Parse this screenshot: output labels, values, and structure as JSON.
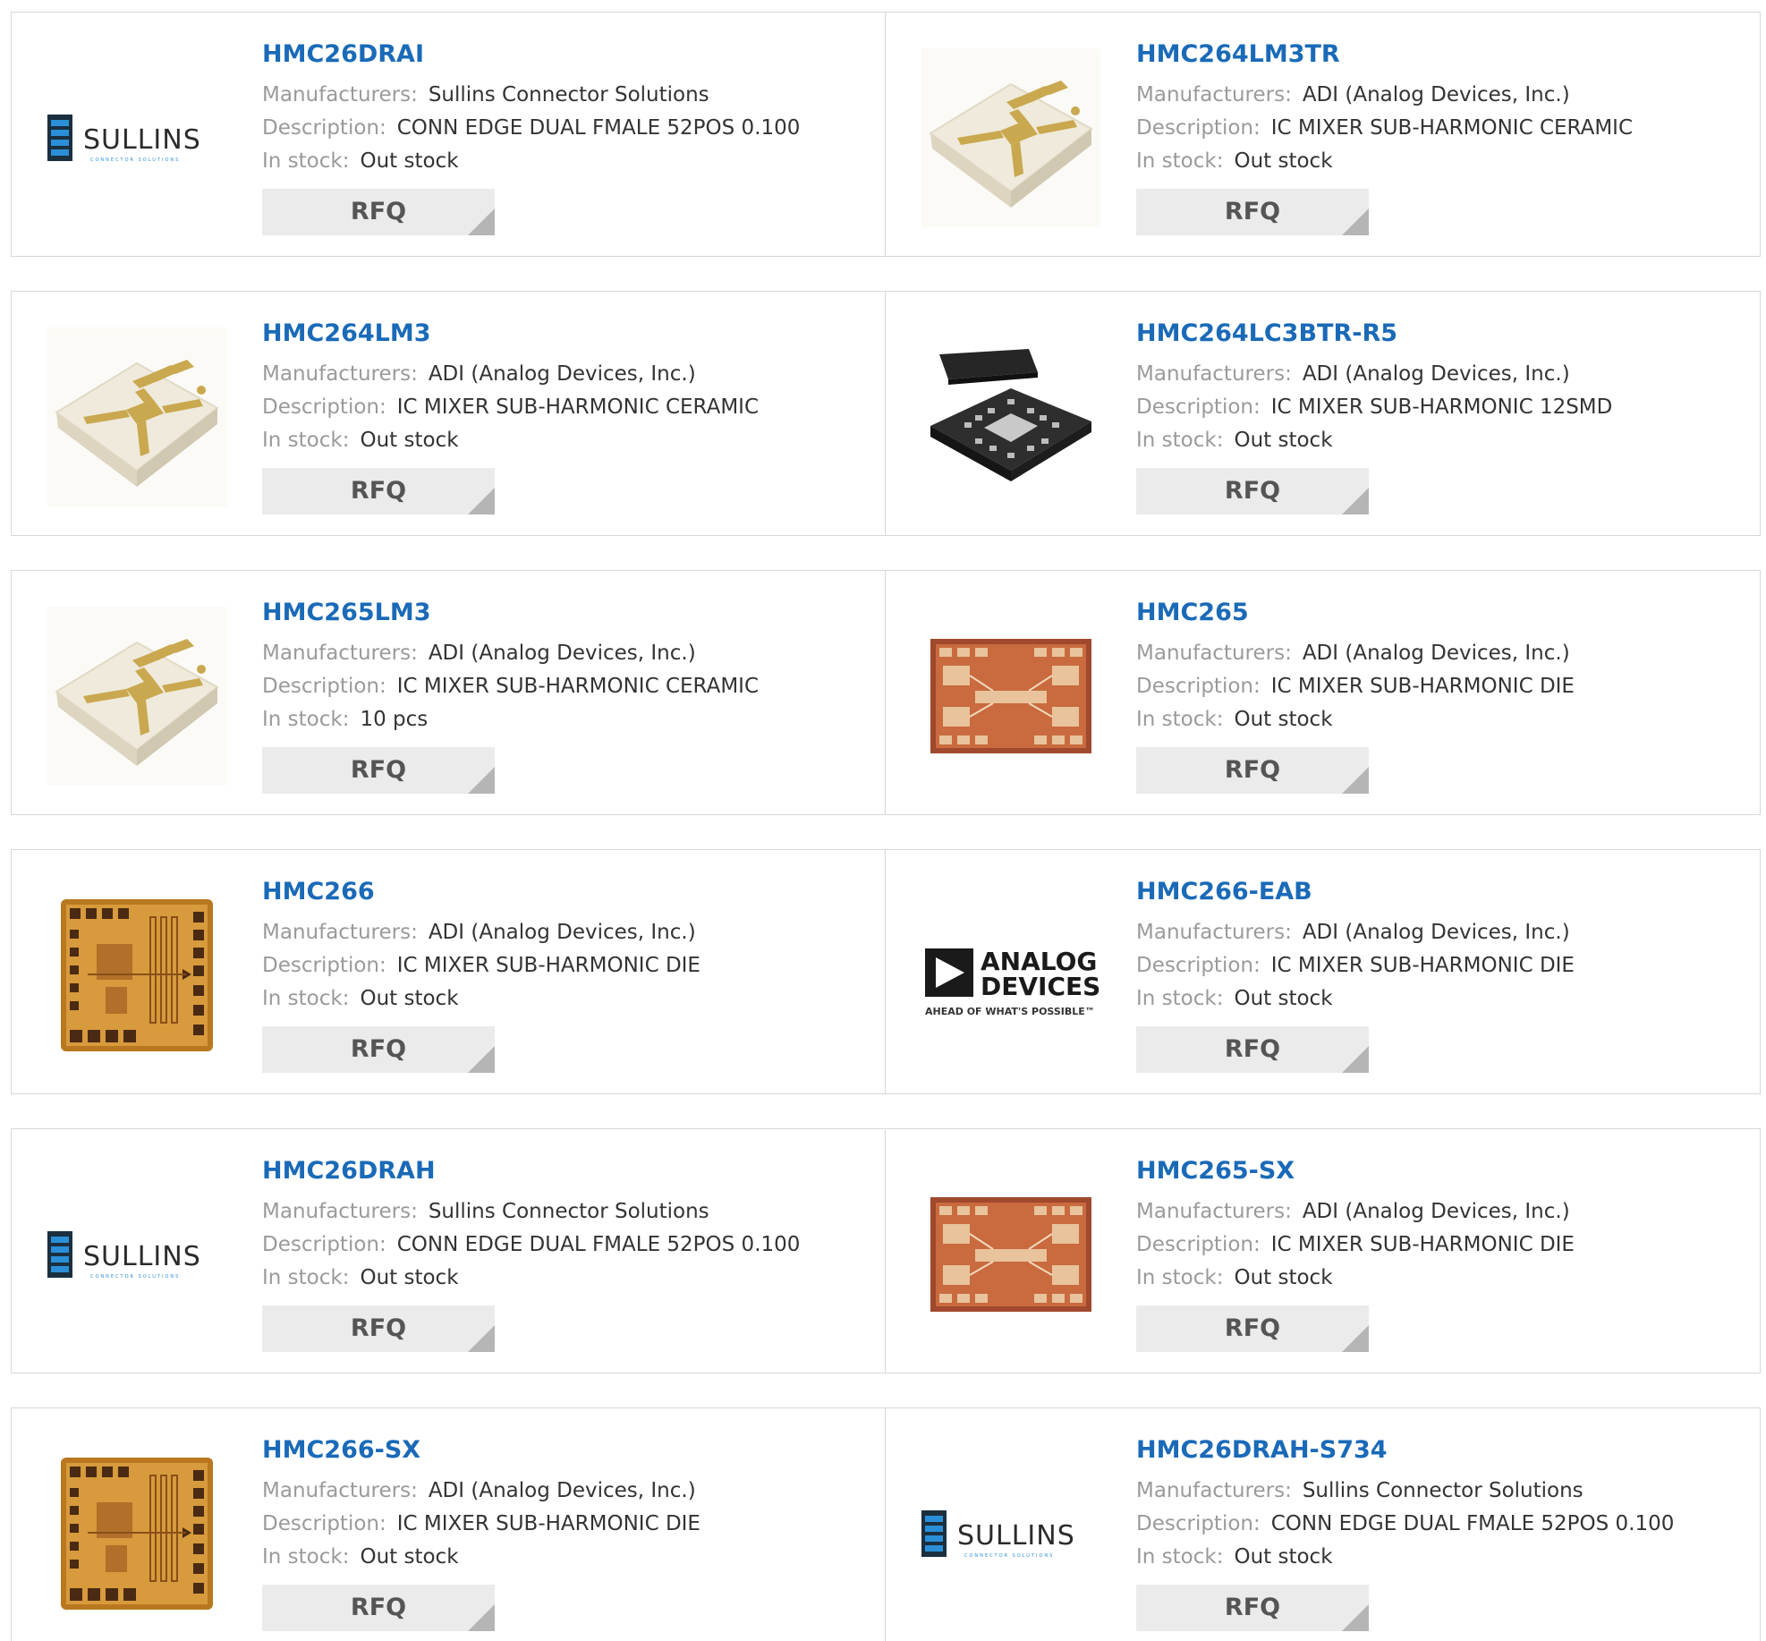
{
  "labels": {
    "manufacturers": "Manufacturers:",
    "description": "Description:",
    "in_stock": "In stock:",
    "rfq": "RFQ"
  },
  "logos": {
    "sullins": "SULLINS",
    "sullins_sub": "CONNECTOR SOLUTIONS",
    "analog_line1": "ANALOG",
    "analog_line2": "DEVICES",
    "analog_tagline": "AHEAD OF WHAT'S POSSIBLE™"
  },
  "colors": {
    "title_link": "#1a6ab8",
    "label": "#9a9a9a",
    "rfq_bg": "#ebebeb",
    "border": "#d7d7d7"
  },
  "products": [
    {
      "part": "HMC26DRAI",
      "manufacturer": "Sullins Connector Solutions",
      "description": "CONN EDGE DUAL FMALE 52POS 0.100",
      "stock": "Out stock",
      "image": "sullins-logo"
    },
    {
      "part": "HMC264LM3TR",
      "manufacturer": "ADI (Analog Devices, Inc.)",
      "description": "IC MIXER SUB-HARMONIC CERAMIC",
      "stock": "Out stock",
      "image": "ceramic-package"
    },
    {
      "part": "HMC264LM3",
      "manufacturer": "ADI (Analog Devices, Inc.)",
      "description": "IC MIXER SUB-HARMONIC CERAMIC",
      "stock": "Out stock",
      "image": "ceramic-package"
    },
    {
      "part": "HMC264LC3BTR-R5",
      "manufacturer": "ADI (Analog Devices, Inc.)",
      "description": "IC MIXER SUB-HARMONIC 12SMD",
      "stock": "Out stock",
      "image": "black-smd-package"
    },
    {
      "part": "HMC265LM3",
      "manufacturer": "ADI (Analog Devices, Inc.)",
      "description": "IC MIXER SUB-HARMONIC CERAMIC",
      "stock": "10 pcs",
      "image": "ceramic-package"
    },
    {
      "part": "HMC265",
      "manufacturer": "ADI (Analog Devices, Inc.)",
      "description": "IC MIXER SUB-HARMONIC DIE",
      "stock": "Out stock",
      "image": "die-wide"
    },
    {
      "part": "HMC266",
      "manufacturer": "ADI (Analog Devices, Inc.)",
      "description": "IC MIXER SUB-HARMONIC DIE",
      "stock": "Out stock",
      "image": "die-square"
    },
    {
      "part": "HMC266-EAB",
      "manufacturer": "ADI (Analog Devices, Inc.)",
      "description": "IC MIXER SUB-HARMONIC DIE",
      "stock": "Out stock",
      "image": "analog-devices-logo"
    },
    {
      "part": "HMC26DRAH",
      "manufacturer": "Sullins Connector Solutions",
      "description": "CONN EDGE DUAL FMALE 52POS 0.100",
      "stock": "Out stock",
      "image": "sullins-logo"
    },
    {
      "part": "HMC265-SX",
      "manufacturer": "ADI (Analog Devices, Inc.)",
      "description": "IC MIXER SUB-HARMONIC DIE",
      "stock": "Out stock",
      "image": "die-wide"
    },
    {
      "part": "HMC266-SX",
      "manufacturer": "ADI (Analog Devices, Inc.)",
      "description": "IC MIXER SUB-HARMONIC DIE",
      "stock": "Out stock",
      "image": "die-square"
    },
    {
      "part": "HMC26DRAH-S734",
      "manufacturer": "Sullins Connector Solutions",
      "description": "CONN EDGE DUAL FMALE 52POS 0.100",
      "stock": "Out stock",
      "image": "sullins-logo"
    }
  ]
}
